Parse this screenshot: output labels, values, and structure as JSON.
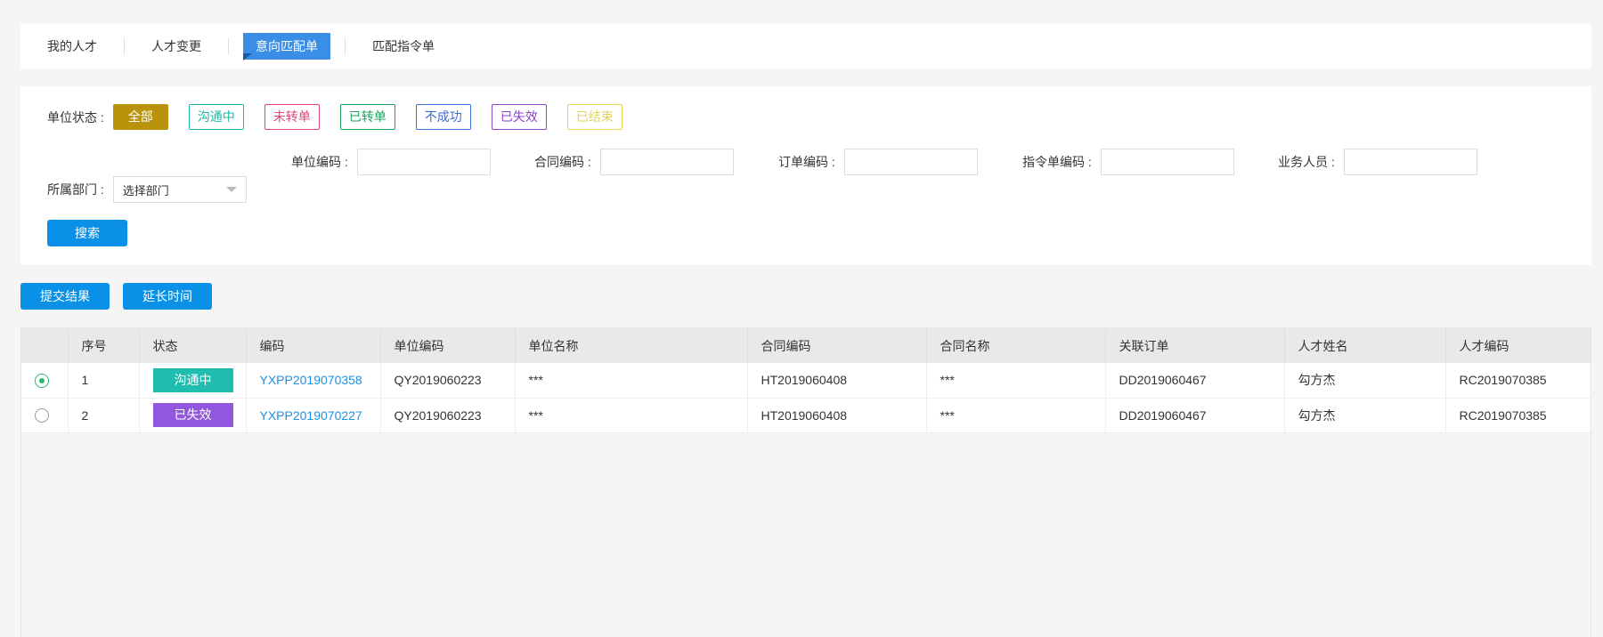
{
  "tabs": [
    {
      "label": "我的人才",
      "active": false
    },
    {
      "label": "人才变更",
      "active": false
    },
    {
      "label": "意向匹配单",
      "active": true
    },
    {
      "label": "匹配指令单",
      "active": false
    }
  ],
  "filters": {
    "status_label": "单位状态 :",
    "statuses": [
      {
        "label": "全部",
        "color": "#b8930b",
        "active": true
      },
      {
        "label": "沟通中",
        "color": "#1fb8a8",
        "active": false
      },
      {
        "label": "未转单",
        "color": "#e0457b",
        "active": false
      },
      {
        "label": "已转单",
        "color": "#1aa260",
        "active": false
      },
      {
        "label": "不成功",
        "color": "#3b6fd8",
        "active": false
      },
      {
        "label": "已失效",
        "color": "#8a44c8",
        "active": false
      },
      {
        "label": "已结束",
        "color": "#e5d35a",
        "active": false
      }
    ],
    "unit_code_label": "单位编码 :",
    "contract_code_label": "合同编码 :",
    "order_code_label": "订单编码 :",
    "instruction_code_label": "指令单编码 :",
    "salesperson_label": "业务人员 :",
    "department_label": "所属部门 :",
    "department_value": "选择部门",
    "search_label": "搜索"
  },
  "actions": {
    "submit_label": "提交结果",
    "extend_label": "延长时间"
  },
  "table": {
    "headers": [
      "",
      "序号",
      "状态",
      "编码",
      "单位编码",
      "单位名称",
      "合同编码",
      "合同名称",
      "关联订单",
      "人才姓名",
      "人才编码"
    ],
    "rows": [
      {
        "selected": true,
        "index": "1",
        "status": "沟通中",
        "status_color": "#1fbcaf",
        "code": "YXPP2019070358",
        "unit_code": "QY2019060223",
        "unit_name": "***",
        "contract_code": "HT2019060408",
        "contract_name": "***",
        "order": "DD2019060467",
        "talent_name": "勾方杰",
        "talent_code": "RC2019070385"
      },
      {
        "selected": false,
        "index": "2",
        "status": "已失效",
        "status_color": "#9157dd",
        "code": "YXPP2019070227",
        "unit_code": "QY2019060223",
        "unit_name": "***",
        "contract_code": "HT2019060408",
        "contract_name": "***",
        "order": "DD2019060467",
        "talent_name": "勾方杰",
        "talent_code": "RC2019070385"
      }
    ]
  }
}
